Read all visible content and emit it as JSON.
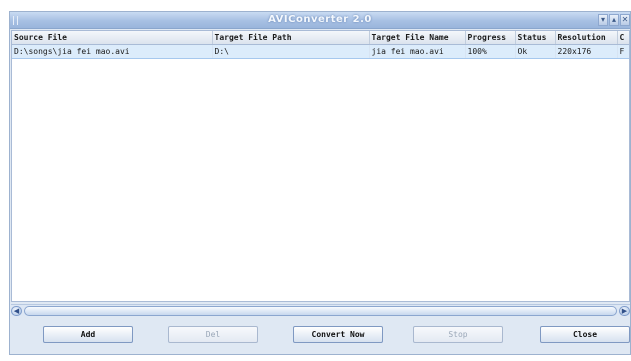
{
  "window": {
    "title": "AVIConverter 2.0",
    "controls": [
      "minimize-icon",
      "restore-icon",
      "close-icon"
    ]
  },
  "table": {
    "columns": [
      "Source File",
      "Target File Path",
      "Target File Name",
      "Progress",
      "Status",
      "Resolution",
      "C"
    ],
    "rows": [
      [
        "D:\\songs\\jia fei mao.avi",
        "D:\\",
        "jia fei mao.avi",
        "100%",
        "Ok",
        "220x176",
        "F"
      ]
    ]
  },
  "buttons": {
    "add": "Add",
    "del": "Del",
    "convert": "Convert Now",
    "stop": "Stop",
    "close": "Close"
  },
  "colors": {
    "titlebar": "#a7c0e3",
    "window_bg": "#dfe8f3",
    "selected_row": "#dcecfb"
  }
}
